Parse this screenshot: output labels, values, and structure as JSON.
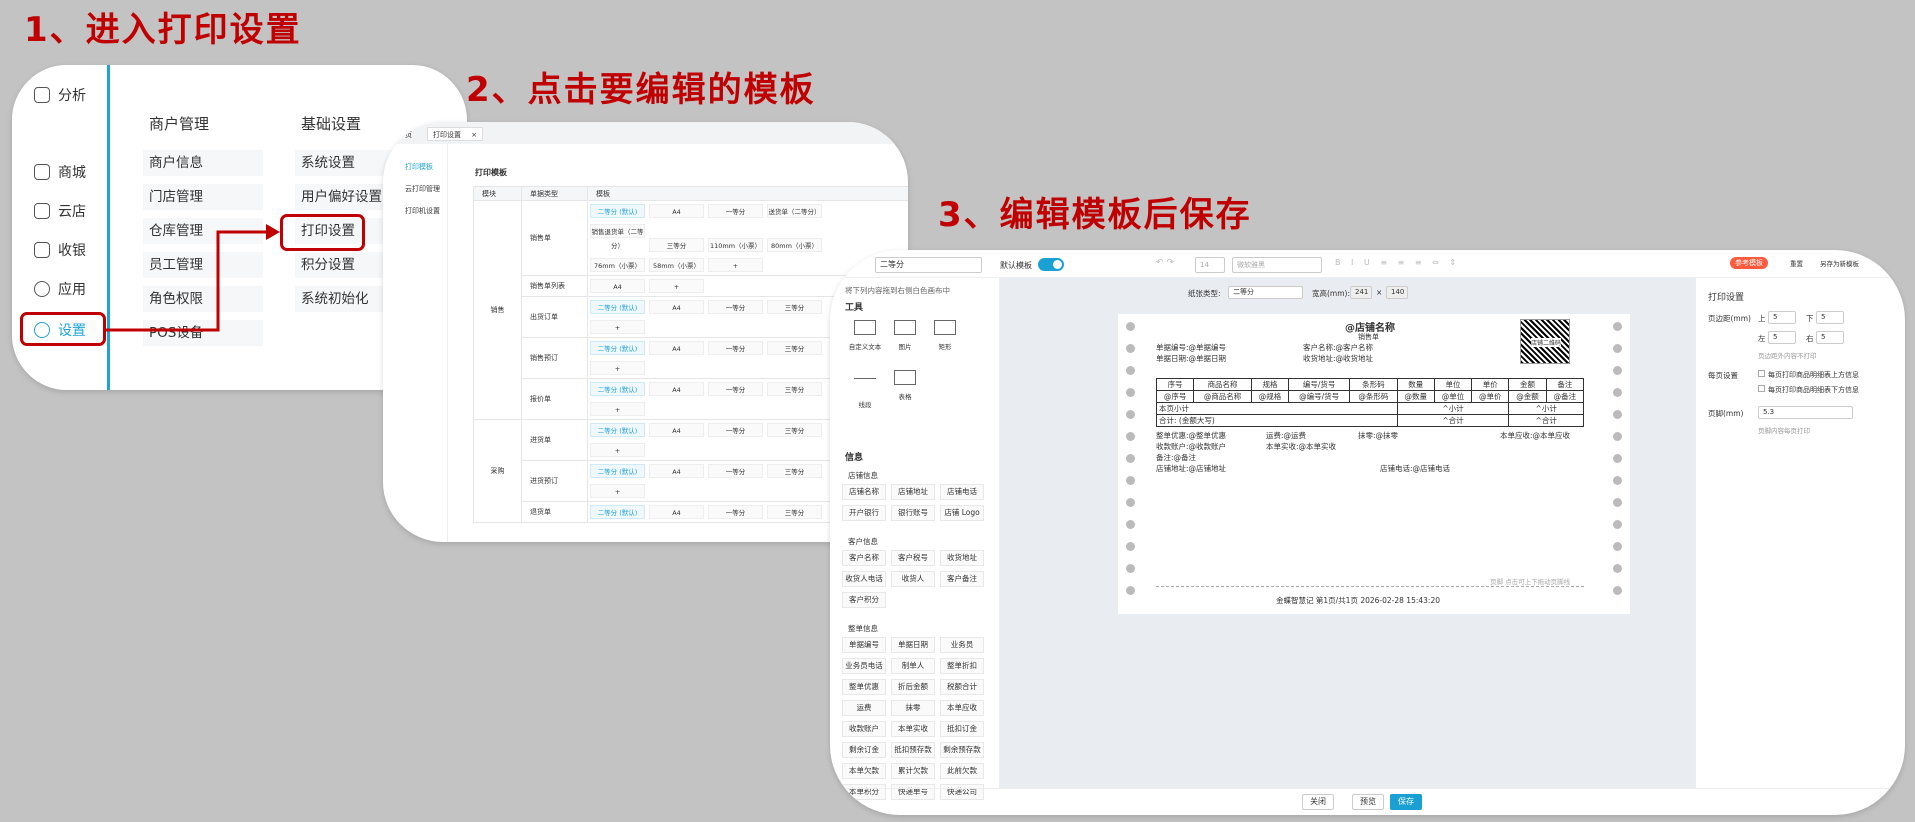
{
  "steps": {
    "s1": "1、进入打印设置",
    "s2": "2、点击要编辑的模板",
    "s3": "3、编辑模板后保存"
  },
  "p1": {
    "nav": [
      {
        "label": "分析",
        "icon": "chart-icon"
      },
      {
        "label": "商城",
        "icon": "home-icon"
      },
      {
        "label": "云店",
        "icon": "store-icon"
      },
      {
        "label": "收银",
        "icon": "cashier-icon"
      },
      {
        "label": "应用",
        "icon": "app-icon"
      },
      {
        "label": "设置",
        "icon": "gear-icon"
      }
    ],
    "col1_title": "商户管理",
    "col1": [
      "商户信息",
      "门店管理",
      "仓库管理",
      "员工管理",
      "角色权限",
      "POS设备"
    ],
    "col2_title": "基础设置",
    "col2": [
      "系统设置",
      "用户偏好设置",
      "打印设置",
      "积分设置",
      "系统初始化"
    ]
  },
  "p2": {
    "tab_prev": "页",
    "tab": "打印设置",
    "tab_close": "×",
    "nav": [
      "打印模板",
      "云打印管理",
      "打印机设置"
    ],
    "title": "打印模板",
    "headers": [
      "模块",
      "单据类型",
      "模板"
    ],
    "group1": "销售",
    "group2": "采购",
    "rows": [
      {
        "type": "销售单",
        "chips": [
          [
            "二等分 (默认)",
            "A4",
            "一等分",
            "送货单（二等分）"
          ],
          [
            "销售退货单（二等分）",
            "三等分",
            "110mm（小票）",
            "80mm（小票）"
          ],
          [
            "76mm（小票）",
            "58mm（小票）",
            "+"
          ]
        ]
      },
      {
        "type": "销售单列表",
        "chips": [
          [
            "A4",
            "+"
          ]
        ]
      },
      {
        "type": "出货订单",
        "chips": [
          [
            "二等分 (默认)",
            "A4",
            "一等分",
            "三等分"
          ],
          [
            "+"
          ]
        ]
      },
      {
        "type": "销售预订",
        "chips": [
          [
            "二等分 (默认)",
            "A4",
            "一等分",
            "三等分"
          ],
          [
            "+"
          ]
        ]
      },
      {
        "type": "报价单",
        "chips": [
          [
            "二等分 (默认)",
            "A4",
            "一等分",
            "三等分"
          ],
          [
            "+"
          ]
        ]
      },
      {
        "type": "进货单",
        "chips": [
          [
            "二等分 (默认)",
            "A4",
            "一等分",
            "三等分"
          ],
          [
            "+"
          ]
        ]
      },
      {
        "type": "进货预订",
        "chips": [
          [
            "二等分 (默认)",
            "A4",
            "一等分",
            "三等分"
          ],
          [
            "+"
          ]
        ]
      },
      {
        "type": "退货单",
        "chips": [
          [
            "二等分 (默认)",
            "A4",
            "一等分",
            "三等分"
          ]
        ]
      }
    ]
  },
  "p3": {
    "name_value": "二等分",
    "default_label": "默认模板",
    "font_size": "14",
    "font_family": "微软雅黑",
    "help_label": "参考模板",
    "reset_label": "重置",
    "saveas_label": "另存为新模板",
    "drag_hint": "将下列内容拖到右侧白色画布中",
    "tools_title": "工具",
    "tools": [
      "自定义文本",
      "图片",
      "矩形",
      "线段",
      "表格"
    ],
    "info_title": "信息",
    "shop_title": "店铺信息",
    "shop": [
      "店铺名称",
      "店铺地址",
      "店铺电话",
      "开户银行",
      "银行账号",
      "店铺 Logo"
    ],
    "cust_title": "客户信息",
    "cust": [
      "客户名称",
      "客户税号",
      "收货地址",
      "收货人电话",
      "收货人",
      "客户备注",
      "客户积分"
    ],
    "doc_title": "整单信息",
    "doc": [
      "单据编号",
      "单据日期",
      "业务员",
      "业务员电话",
      "制单人",
      "整单折扣",
      "整单优惠",
      "折后金额",
      "税额合计",
      "运费",
      "抹零",
      "本单应收",
      "收款账户",
      "本单实收",
      "抵扣订金",
      "剩余订金",
      "抵扣预存款",
      "剩余预存款",
      "本单欠款",
      "累计欠款",
      "此前欠款",
      "本单积分",
      "快递单号",
      "快递公司"
    ],
    "paper_type_label": "纸张类型:",
    "paper_type": "二等分",
    "size_label": "宽高(mm):",
    "width": "241",
    "height": "140",
    "size_sep": "×",
    "paper": {
      "shop_name": "@店铺名称",
      "doc_name": "销售单",
      "doc_no": "单据编号:@单据编号",
      "doc_date": "单据日期:@单据日期",
      "cust_name": "客户名称:@客户名称",
      "addr": "收货地址:@收货地址",
      "qr_text": "店铺二维码",
      "cols": [
        "序号",
        "商品名称",
        "规格",
        "编号/货号",
        "条形码",
        "数量",
        "单位",
        "单价",
        "金额",
        "备注"
      ],
      "vals": [
        "@序号",
        "@商品名称",
        "@规格",
        "@编号/货号",
        "@条形码",
        "@数量",
        "@单位",
        "@单价",
        "@金额",
        "@备注"
      ],
      "subtotal": "本页小计",
      "subtotal_v": "^小计",
      "subtotal_v2": "^小计",
      "total": "合计: (金额大写)",
      "total_v": "^合计",
      "total_v2": "^合计",
      "l1": [
        "整单优惠:@整单优惠",
        "运费:@运费",
        "抹零:@抹零",
        "本单应收:@本单应收"
      ],
      "l2": [
        "收款账户:@收款账户",
        "本单实收:@本单实收"
      ],
      "l3": "备注:@备注",
      "l4": [
        "店铺地址:@店铺地址",
        "店铺电话:@店铺电话"
      ],
      "footer_hint": "页脚 点击可上下拖动页脚线",
      "footer": "金蝶智慧记  第1页/共1页  2026-02-28 15:43:20"
    },
    "right_title": "打印设置",
    "margin_label": "页边距(mm)",
    "top": "上",
    "bottom": "下",
    "left": "左",
    "right": "右",
    "m_top": "5",
    "m_bottom": "5",
    "m_left": "5",
    "m_right": "5",
    "margin_note": "页边距外内容不打印",
    "page_label": "每页设置",
    "page_opt1": "每页打印商品明细表上方信息",
    "page_opt2": "每页打印商品明细表下方信息",
    "footer_label": "页脚(mm)",
    "footer_value": "5.3",
    "footer_note": "页脚内容每页打印",
    "close": "关闭",
    "preview": "预览",
    "save": "保存"
  },
  "colors": {
    "red": "#c00000",
    "accent": "#1aa0d3"
  }
}
